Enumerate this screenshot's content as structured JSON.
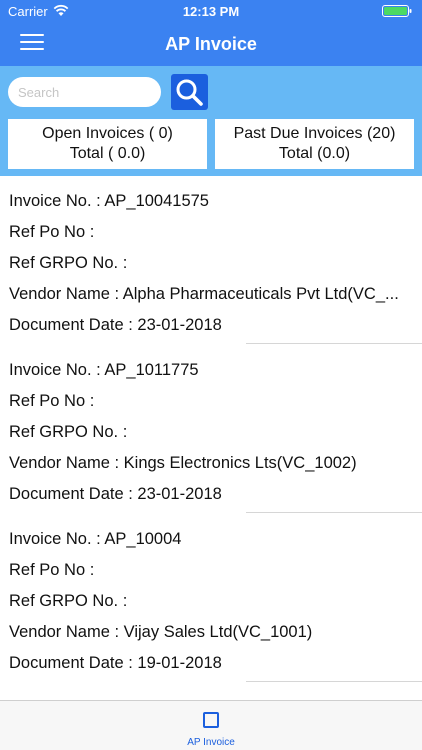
{
  "status_bar": {
    "carrier": "Carrier",
    "time": "12:13 PM"
  },
  "nav": {
    "title": "AP Invoice",
    "menu_icon": "hamburger-menu-icon"
  },
  "search": {
    "placeholder": "Search",
    "value": "",
    "button_icon": "search-icon"
  },
  "summary": {
    "open": {
      "line1": "Open Invoices ( 0)",
      "line2": "Total ( 0.0)"
    },
    "past_due": {
      "line1": "Past Due Invoices (20)",
      "line2": "Total (0.0)"
    }
  },
  "invoices": [
    {
      "invoice_no": "Invoice No. : AP_10041575",
      "ref_po": "Ref Po No :",
      "ref_grpo": "Ref GRPO No. :",
      "vendor": "Vendor Name : Alpha Pharmaceuticals Pvt Ltd(VC_...",
      "date": "Document Date : 23-01-2018"
    },
    {
      "invoice_no": "Invoice No. : AP_1011775",
      "ref_po": "Ref Po No :",
      "ref_grpo": "Ref GRPO No. :",
      "vendor": "Vendor Name : Kings Electronics Lts(VC_1002)",
      "date": "Document Date : 23-01-2018"
    },
    {
      "invoice_no": "Invoice No. : AP_10004",
      "ref_po": "Ref Po No :",
      "ref_grpo": "Ref GRPO No. :",
      "vendor": "Vendor Name : Vijay Sales Ltd(VC_1001)",
      "date": "Document Date : 19-01-2018"
    }
  ],
  "tab_bar": {
    "items": [
      {
        "label": "AP Invoice",
        "icon": "square-icon"
      }
    ]
  },
  "colors": {
    "nav_blue": "#3b82f1",
    "search_area": "#66b8f5",
    "accent_dark_blue": "#1b5fde"
  }
}
